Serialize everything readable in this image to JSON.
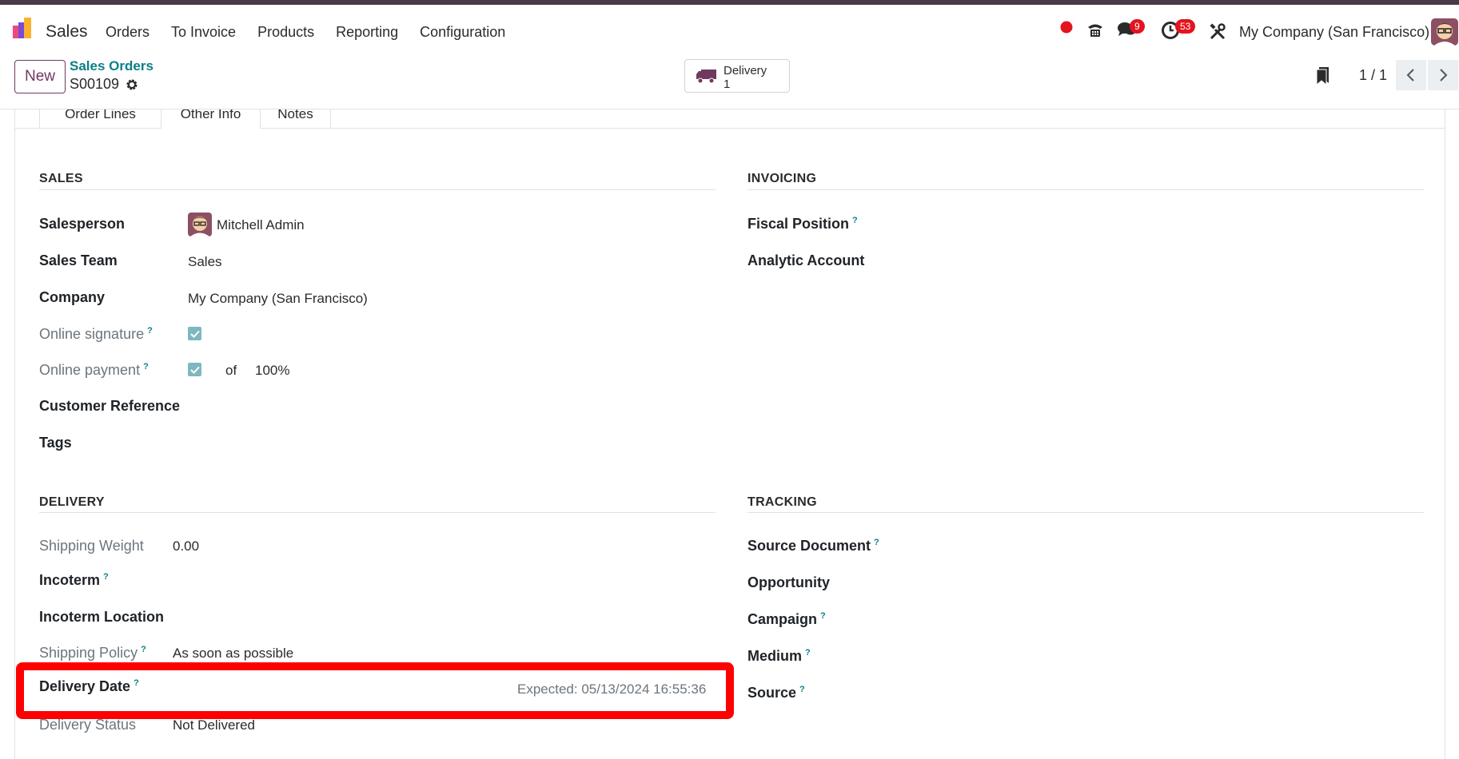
{
  "navbar": {
    "app_name": "Sales",
    "menu": [
      "Orders",
      "To Invoice",
      "Products",
      "Reporting",
      "Configuration"
    ],
    "messages_badge": "9",
    "activities_badge": "53",
    "company": "My Company (San Francisco)"
  },
  "control_panel": {
    "new_label": "New",
    "breadcrumb_parent": "Sales Orders",
    "record_name": "S00109",
    "smart_button": {
      "label": "Delivery",
      "value": "1"
    },
    "pager": "1 / 1"
  },
  "tabs": [
    "Order Lines",
    "Other Info",
    "Notes"
  ],
  "sales": {
    "title": "SALES",
    "salesperson_label": "Salesperson",
    "salesperson_value": "Mitchell Admin",
    "team_label": "Sales Team",
    "team_value": "Sales",
    "company_label": "Company",
    "company_value": "My Company (San Francisco)",
    "signature_label": "Online signature",
    "payment_label": "Online payment",
    "payment_of": "of",
    "payment_pct": "100%",
    "customer_ref_label": "Customer Reference",
    "tags_label": "Tags"
  },
  "invoicing": {
    "title": "INVOICING",
    "fiscal_label": "Fiscal Position",
    "analytic_label": "Analytic Account"
  },
  "delivery": {
    "title": "DELIVERY",
    "weight_label": "Shipping Weight",
    "weight_value": "0.00",
    "incoterm_label": "Incoterm",
    "incoterm_location_label": "Incoterm Location",
    "policy_label": "Shipping Policy",
    "policy_value": "As soon as possible",
    "date_label": "Delivery Date",
    "date_value": "Expected: 05/13/2024 16:55:36",
    "status_label": "Delivery Status",
    "status_value": "Not Delivered"
  },
  "tracking": {
    "title": "TRACKING",
    "source_doc_label": "Source Document",
    "opportunity_label": "Opportunity",
    "campaign_label": "Campaign",
    "medium_label": "Medium",
    "source_label": "Source"
  },
  "help_mark": "?",
  "colors": {
    "brand": "#71395f",
    "link": "#0b7f86",
    "highlight": "#ff0000",
    "badge": "#e3141f"
  }
}
